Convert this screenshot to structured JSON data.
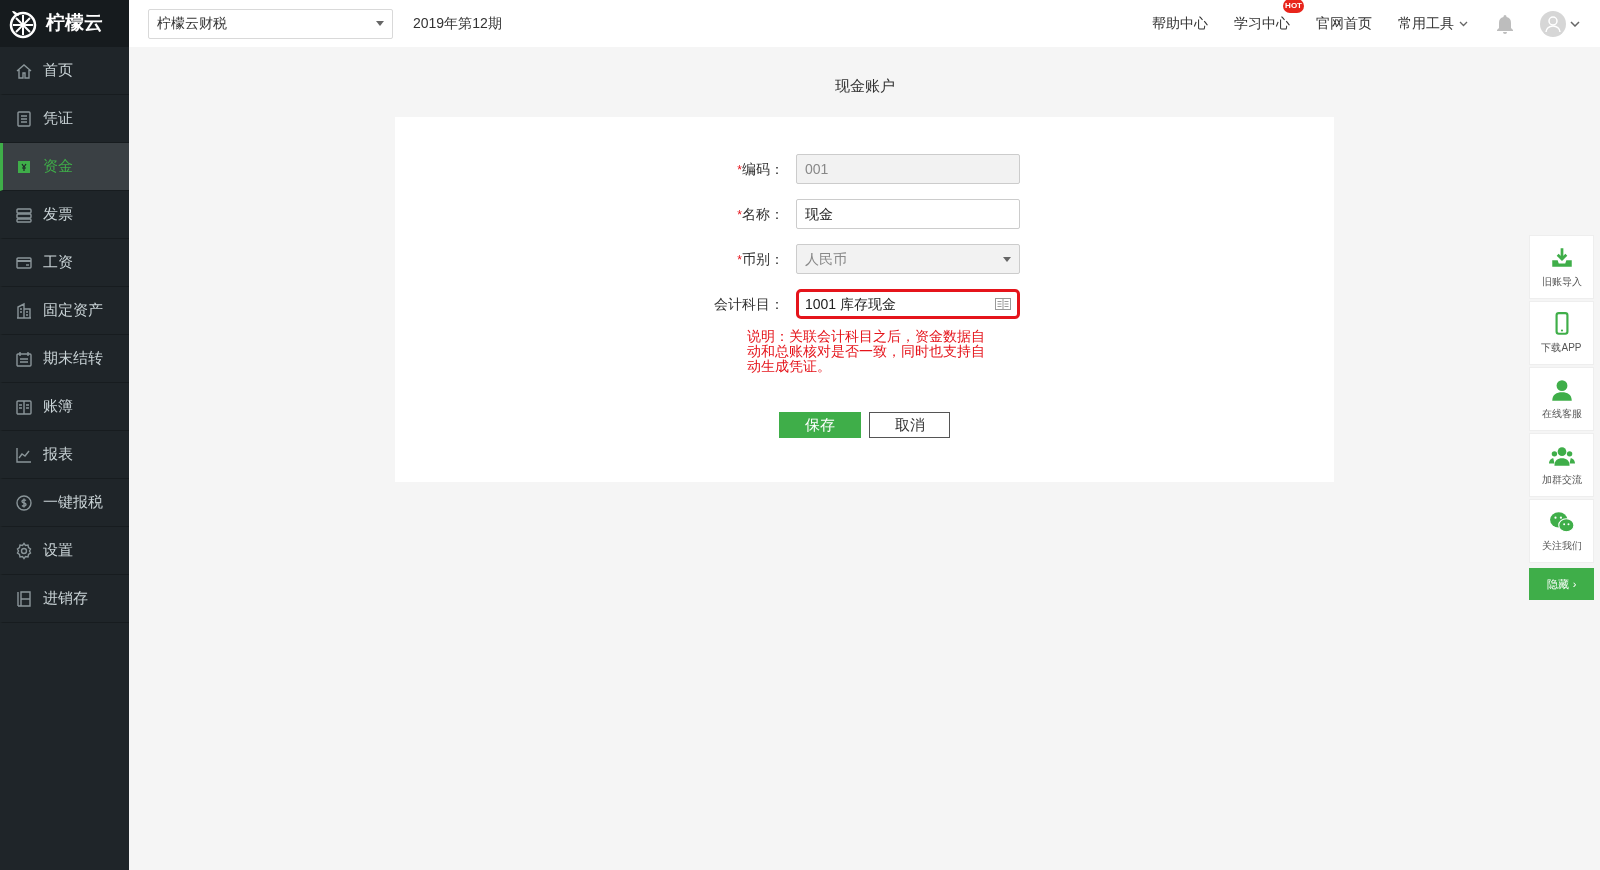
{
  "brand": {
    "name": "柠檬云"
  },
  "topbar": {
    "company": "柠檬云财税",
    "period": "2019年第12期",
    "links": [
      {
        "label": "帮助中心"
      },
      {
        "label": "学习中心",
        "badge": "HOT"
      },
      {
        "label": "官网首页"
      },
      {
        "label": "常用工具",
        "dropdown": true
      }
    ]
  },
  "sidebar": {
    "items": [
      {
        "label": "首页",
        "selected": false
      },
      {
        "label": "凭证",
        "selected": false
      },
      {
        "label": "资金",
        "selected": true
      },
      {
        "label": "发票",
        "selected": false
      },
      {
        "label": "工资",
        "selected": false
      },
      {
        "label": "固定资产",
        "selected": false
      },
      {
        "label": "期末结转",
        "selected": false
      },
      {
        "label": "账簿",
        "selected": false
      },
      {
        "label": "报表",
        "selected": false
      },
      {
        "label": "一键报税",
        "selected": false
      },
      {
        "label": "设置",
        "selected": false
      },
      {
        "label": "进销存",
        "selected": false
      }
    ]
  },
  "page": {
    "title": "现金账户"
  },
  "form": {
    "fields": [
      {
        "kind": "text",
        "mark": "*",
        "label": "编码：",
        "value": "001",
        "disabled": true,
        "highlighted": false
      },
      {
        "kind": "text",
        "mark": "*",
        "label": "名称：",
        "value": "现金",
        "disabled": false,
        "highlighted": false
      },
      {
        "kind": "select",
        "mark": "*",
        "label": "币别：",
        "value": "人民币",
        "disabled": true,
        "highlighted": false
      },
      {
        "kind": "picker",
        "label": "会计科目：",
        "value": "1001 库存现金",
        "disabled": false,
        "highlighted": true
      }
    ],
    "note": "说明：关联会计科目之后，资金数据自动和总账核对是否一致，同时也支持自动生成凭证。",
    "buttons": [
      {
        "kind": "primary",
        "label": "保存"
      },
      {
        "kind": "secondary",
        "label": "取消"
      }
    ]
  },
  "float_panel": {
    "items": [
      {
        "label": "旧账导入"
      },
      {
        "label": "下载APP"
      },
      {
        "label": "在线客服"
      },
      {
        "label": "加群交流"
      },
      {
        "label": "关注我们"
      }
    ],
    "hide_button": {
      "label": "隐藏",
      "arrow": "›"
    }
  }
}
